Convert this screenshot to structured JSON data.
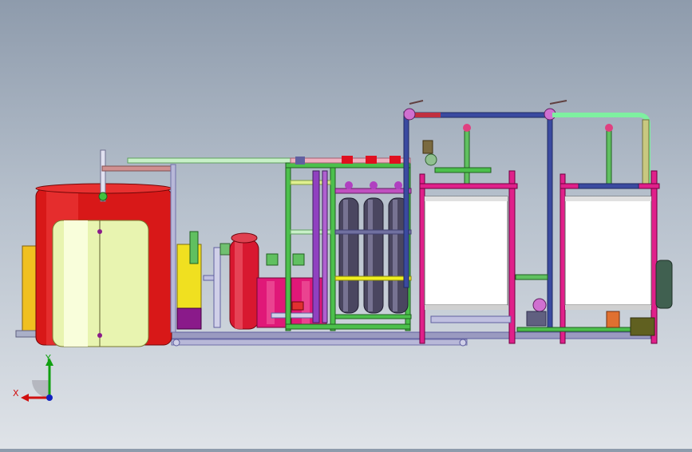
{
  "window": {
    "title": ""
  },
  "colors": {
    "background_top": "#8e9bac",
    "background_bottom": "#dfe3e8",
    "tank_red": "#d81818",
    "tank_cream": "#e8f4b0",
    "membrane_vessel": "#4a4660",
    "frame_green": "#4cc04c",
    "frame_magenta": "#e0209a",
    "pipe_blue": "#7090c8",
    "pipe_gray": "#b0b0c0",
    "pump_yellow": "#f0e020"
  },
  "triad": {
    "x_label": "X",
    "y_label": "Y",
    "x_color": "#d01010",
    "y_color": "#10a010",
    "z_color": "#1020c0"
  },
  "components": {
    "storage_tank_red": "storage-tank",
    "storage_tank_cream": "storage-tank",
    "pressure_vessels": [
      "vessel-1",
      "vessel-2",
      "vessel-3"
    ],
    "filter_red": "multimedia-filter",
    "dosing_tanks": [
      "dosing-tank-1",
      "dosing-tank-2"
    ],
    "cabinet_left": "control-cabinet",
    "cabinet_right": "control-cabinet"
  }
}
